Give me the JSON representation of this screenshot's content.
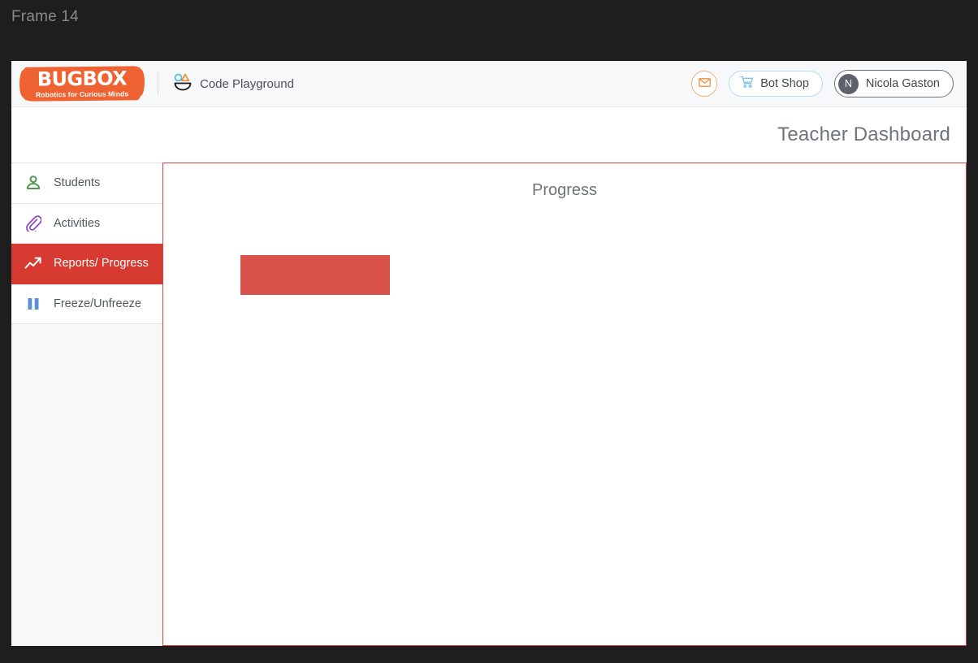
{
  "frame": {
    "label": "Frame 14"
  },
  "topbar": {
    "logo": {
      "name": "BUGBOX",
      "tagline": "Robotics for Curious Minds"
    },
    "playground": {
      "label": "Code Playground",
      "icon": "code-playground-icon"
    },
    "mail": {
      "icon": "mail-icon"
    },
    "bot_shop": {
      "label": "Bot Shop",
      "icon": "shopping-cart-icon"
    },
    "user": {
      "name": "Nicola Gaston",
      "initial": "N"
    }
  },
  "header": {
    "title": "Teacher Dashboard"
  },
  "sidebar": {
    "items": [
      {
        "label": "Students",
        "icon": "person-icon",
        "active": false
      },
      {
        "label": "Activities",
        "icon": "paperclip-icon",
        "active": false
      },
      {
        "label": "Reports/ Progress",
        "icon": "trending-up-icon",
        "active": true
      },
      {
        "label": "Freeze/Unfreeze",
        "icon": "pause-icon",
        "active": false
      }
    ]
  },
  "main": {
    "title": "Progress",
    "block": {
      "label": "",
      "color": "#d9534a"
    }
  },
  "colors": {
    "brand_orange": "#ef6333",
    "accent_red": "#d63a30",
    "panel_border": "#d1453b",
    "block_red": "#d9534a",
    "icon_green": "#4f9a4f",
    "icon_purple": "#8e44c4",
    "icon_blue": "#5b8fd4",
    "desktop_bg": "#1e1e1e"
  }
}
